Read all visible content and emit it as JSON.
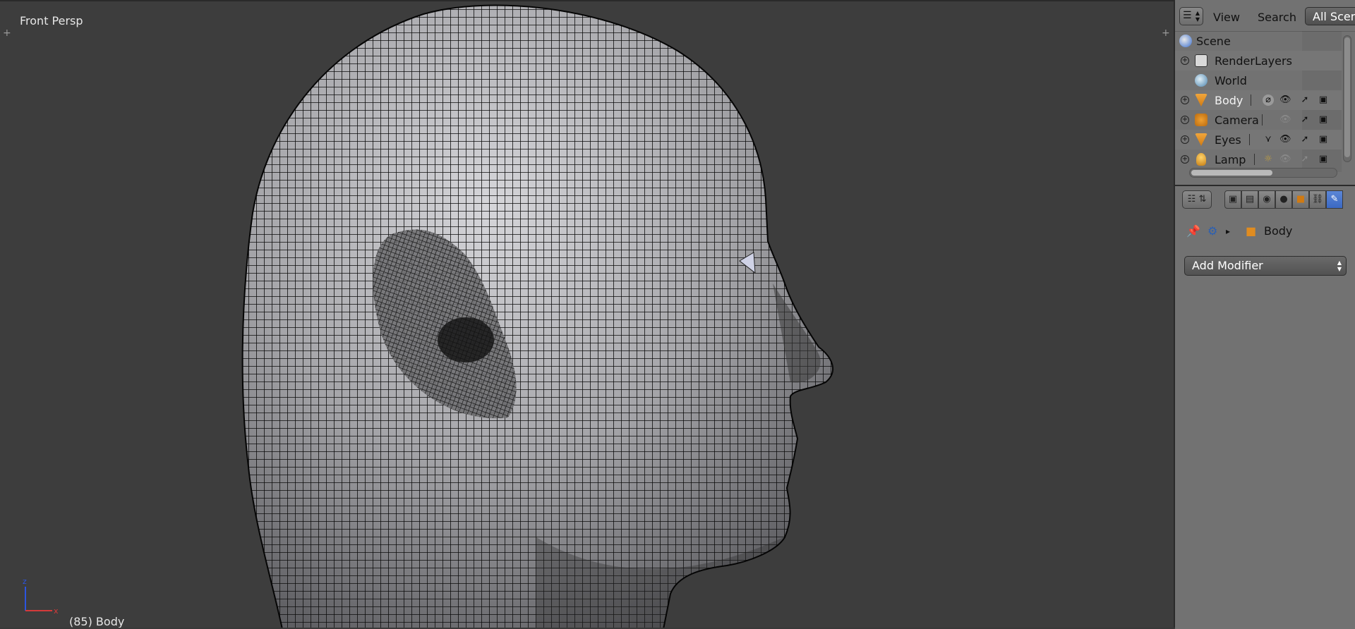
{
  "viewport": {
    "view_label": "Front Persp",
    "object_label": "(85) Body",
    "axis_z": "z",
    "axis_x": "x",
    "plus": "+"
  },
  "outliner": {
    "header": {
      "display_mode_icon": "outliner-icon",
      "menu_view": "View",
      "menu_search": "Search",
      "filter_button": "All Scenes"
    },
    "items": [
      {
        "label": "Scene",
        "icon": "scene-icon"
      },
      {
        "label": "RenderLayers",
        "icon": "renderlayers-icon"
      },
      {
        "label": "World",
        "icon": "world-icon"
      },
      {
        "label": "Body",
        "icon": "mesh-icon"
      },
      {
        "label": "Camera",
        "icon": "camera-icon"
      },
      {
        "label": "Eyes",
        "icon": "mesh-icon"
      },
      {
        "label": "Lamp",
        "icon": "lamp-icon"
      }
    ]
  },
  "properties": {
    "context_tabs": [
      "render",
      "renderlayers",
      "scene",
      "world",
      "object",
      "constraints",
      "modifiers"
    ],
    "breadcrumb_object": "Body",
    "add_modifier_label": "Add Modifier"
  },
  "colors": {
    "viewport_bg": "#3d3d3d",
    "panel_bg": "#727272",
    "mesh_fill": "#b4b4b8",
    "wire": "#0a0a0a",
    "accent_blue": "#3b69c4",
    "object_orange": "#e08c20"
  }
}
